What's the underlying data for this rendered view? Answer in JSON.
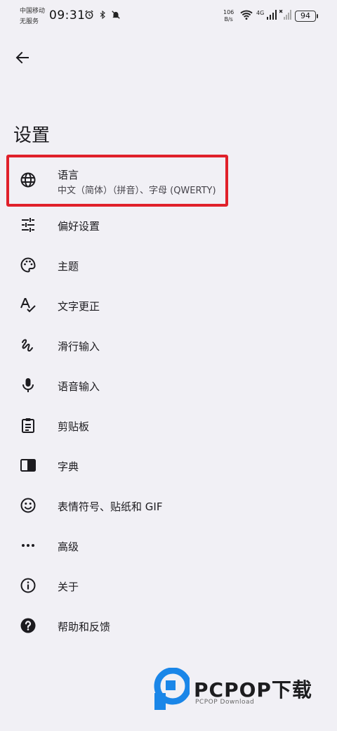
{
  "status_bar": {
    "carrier_line1": "中国移动",
    "carrier_line2": "无服务",
    "time": "09:31",
    "net_speed_value": "106",
    "net_speed_unit": "B/s",
    "network_type": "4G",
    "battery": "94"
  },
  "header": {
    "title": "设置"
  },
  "menu": [
    {
      "label": "语言",
      "sublabel": "中文（简体）（拼音）、字母 (QWERTY)",
      "icon": "globe-icon"
    },
    {
      "label": "偏好设置",
      "icon": "tune-icon"
    },
    {
      "label": "主题",
      "icon": "palette-icon"
    },
    {
      "label": "文字更正",
      "icon": "spellcheck-icon"
    },
    {
      "label": "滑行输入",
      "icon": "gesture-icon"
    },
    {
      "label": "语音输入",
      "icon": "mic-icon"
    },
    {
      "label": "剪贴板",
      "icon": "clipboard-icon"
    },
    {
      "label": "字典",
      "icon": "dictionary-icon"
    },
    {
      "label": "表情符号、贴纸和 GIF",
      "icon": "emoji-icon"
    },
    {
      "label": "高级",
      "icon": "more-horiz-icon"
    },
    {
      "label": "关于",
      "icon": "info-icon"
    },
    {
      "label": "帮助和反馈",
      "icon": "help-icon"
    }
  ],
  "watermark": {
    "text": "PCPOP下载",
    "sub": "PCPOP Download"
  },
  "colors": {
    "background": "#f1f0f5",
    "highlight": "#e0202a",
    "watermark_blue": "#1a86e8"
  }
}
